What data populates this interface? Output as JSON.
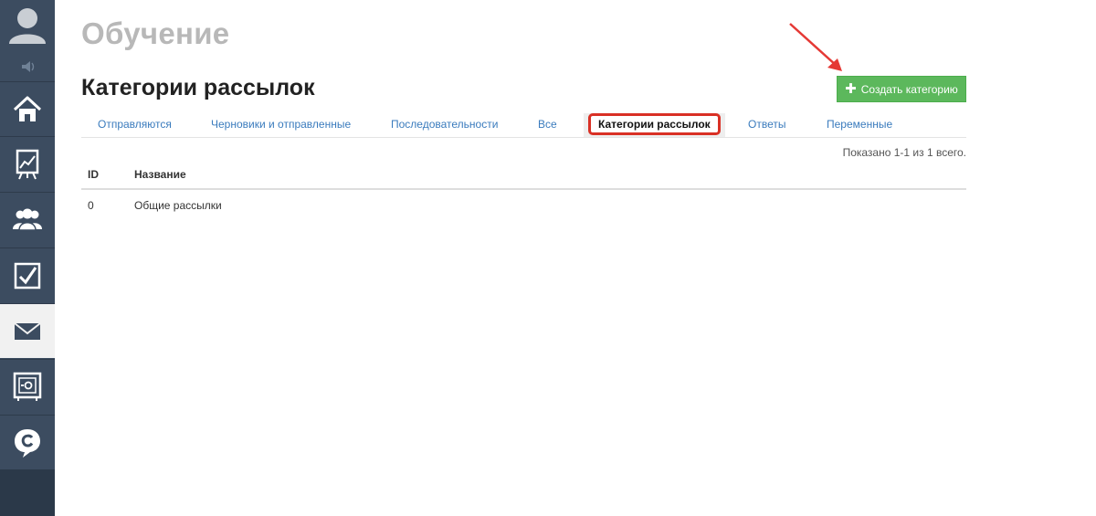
{
  "header": {
    "workspace_title": "Обучение",
    "page_title": "Категории рассылок",
    "create_button_label": "Создать категорию"
  },
  "sidebar": {
    "items": [
      {
        "icon": "home-icon"
      },
      {
        "icon": "chart-icon"
      },
      {
        "icon": "users-icon"
      },
      {
        "icon": "checkbox-icon"
      },
      {
        "icon": "mail-icon",
        "active": true
      },
      {
        "icon": "safe-icon"
      },
      {
        "icon": "chat-icon"
      }
    ]
  },
  "tabs": [
    {
      "label": "Отправляются"
    },
    {
      "label": "Черновики и отправленные"
    },
    {
      "label": "Последовательности"
    },
    {
      "label": "Все"
    },
    {
      "label": "Категории рассылок",
      "active": true
    },
    {
      "label": "Ответы"
    },
    {
      "label": "Переменные"
    }
  ],
  "summary": "Показано 1-1 из 1 всего.",
  "table": {
    "columns": [
      "ID",
      "Название"
    ],
    "rows": [
      [
        "0",
        "Общие рассылки"
      ]
    ]
  },
  "colors": {
    "sidebar": "#3c4c60",
    "accent_green": "#5cb85c",
    "link_blue": "#3a7bbd",
    "highlight_red": "#d93025"
  }
}
